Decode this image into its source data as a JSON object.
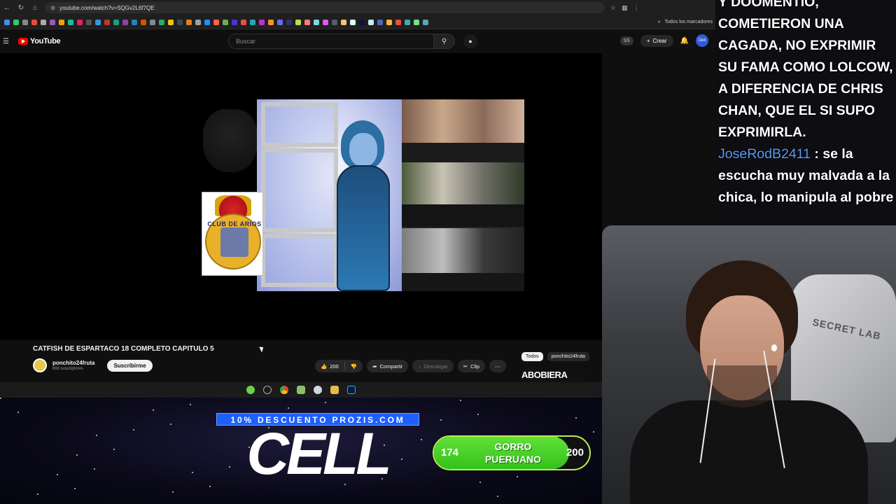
{
  "browser": {
    "url": "youtube.com/watch?v=SQGv2L6f7QE",
    "bookmarks_folder": "Todos los marcadores"
  },
  "youtube": {
    "logo_text": "YouTube",
    "search": {
      "placeholder": "Buscar",
      "value": ""
    },
    "header": {
      "ss_badge": "SS",
      "create_label": "Crear",
      "avatar_label": "Deli"
    }
  },
  "video": {
    "title": "CATFISH DE ESPARTACO 18 COMPLETO CAPITULO 5",
    "channel_name": "ponchito24fruta",
    "subscribers": "693 suscriptores",
    "subscribe_label": "Suscribirme",
    "likes": "200",
    "share_label": "Compartir",
    "download_label": "Descargar",
    "clip_label": "Clip",
    "thumbnail_badge_text": "CLUB DE ARIOS"
  },
  "related": {
    "chips": [
      "Todos",
      "ponchito24fruta"
    ],
    "first_thumb_text": "ABOBIERA"
  },
  "chat": {
    "lines": [
      {
        "user": "",
        "text": "Y DOOMENTIO, COMETIERON UNA CAGADA, NO EXPRIMIR SU FAMA COMO LOLCOW, A DIFERENCIA DE CHRIS CHAN, QUE EL SI SUPO EXPRIMIRLA."
      },
      {
        "user": "JoseRodB2411",
        "text": " : se la escucha muy malvada a la chica, lo manipula al pobre"
      }
    ]
  },
  "overlay": {
    "promo": "10% DESCUENTO PROZIS.COM",
    "cell": "CELL",
    "goal": {
      "label": "GORRO PUERUANO",
      "current": 174,
      "target": 200
    }
  },
  "webcam": {
    "chair_label": "SECRET LAB"
  },
  "colors": {
    "youtube_red": "#ff0000",
    "goal_green": "#47d42a",
    "promo_blue": "#1d60ff",
    "chat_user": "#5c9cf5"
  }
}
